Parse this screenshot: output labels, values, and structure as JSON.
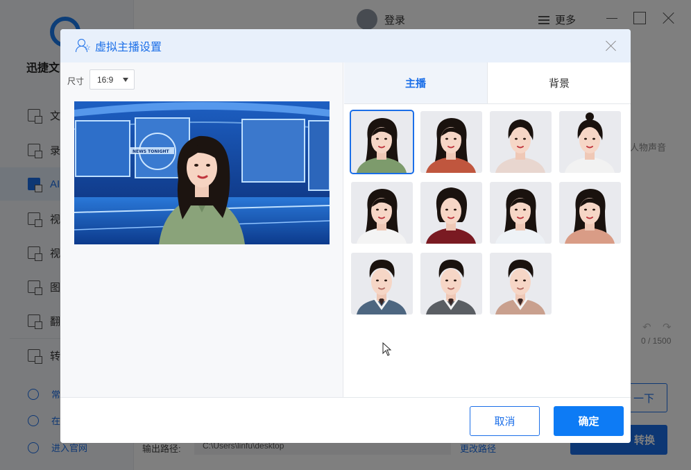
{
  "app": {
    "logo_text": "迅捷文",
    "nav": [
      {
        "label": "文",
        "icon": "doc-icon"
      },
      {
        "label": "录",
        "icon": "record-icon"
      },
      {
        "label": "AI",
        "icon": "ai-icon",
        "active": true
      },
      {
        "label": "视",
        "icon": "video-icon"
      },
      {
        "label": "视",
        "icon": "video2-icon"
      },
      {
        "label": "图",
        "icon": "image-icon"
      },
      {
        "label": "翻",
        "icon": "translate-icon"
      },
      {
        "label": "转",
        "icon": "convert-icon"
      }
    ],
    "footer": [
      {
        "label": "常",
        "icon": "help-icon"
      },
      {
        "label": "在",
        "icon": "headset-icon"
      },
      {
        "label": "进入官网",
        "icon": "monitor-icon"
      }
    ],
    "topbar": {
      "login": "登录",
      "more": "更多"
    },
    "bg": {
      "hint": "人物声音",
      "counter": "0 / 1500",
      "next": "一下",
      "start": "转换",
      "output_label": "输出路径:",
      "output_path": "C:\\Users\\linfu\\desktop",
      "change_path": "更改路径"
    }
  },
  "modal": {
    "title": "虚拟主播设置",
    "size_label": "尺寸",
    "size_value": "16:9",
    "tabs": [
      {
        "label": "主播",
        "active": true
      },
      {
        "label": "背景",
        "active": false
      }
    ],
    "anchors": [
      {
        "gender": "female",
        "hair": "long",
        "clothing": "#7d9b6c",
        "selected": true
      },
      {
        "gender": "female",
        "hair": "long",
        "clothing": "#c0563e"
      },
      {
        "gender": "female",
        "hair": "tied",
        "clothing": "#e8d6cf"
      },
      {
        "gender": "female",
        "hair": "bun",
        "clothing": "#f2f2f2"
      },
      {
        "gender": "female",
        "hair": "long",
        "clothing": "#f4f4f4"
      },
      {
        "gender": "female",
        "hair": "short",
        "clothing": "#7a1a22"
      },
      {
        "gender": "female",
        "hair": "long",
        "clothing": "#eef2f6"
      },
      {
        "gender": "female",
        "hair": "long",
        "clothing": "#d99c86"
      },
      {
        "gender": "male",
        "hair": "short",
        "clothing": "#4d6680"
      },
      {
        "gender": "male",
        "hair": "short",
        "clothing": "#5a5e63"
      },
      {
        "gender": "male",
        "hair": "short",
        "clothing": "#c9a08e"
      }
    ],
    "preview": {
      "studio_text": "NEWS TONIGHT",
      "anchor_clothing": "#8aa37a"
    },
    "cancel_label": "取消",
    "ok_label": "确定"
  },
  "colors": {
    "accent": "#1a6ee8",
    "primary_button": "#0d7bf5"
  }
}
